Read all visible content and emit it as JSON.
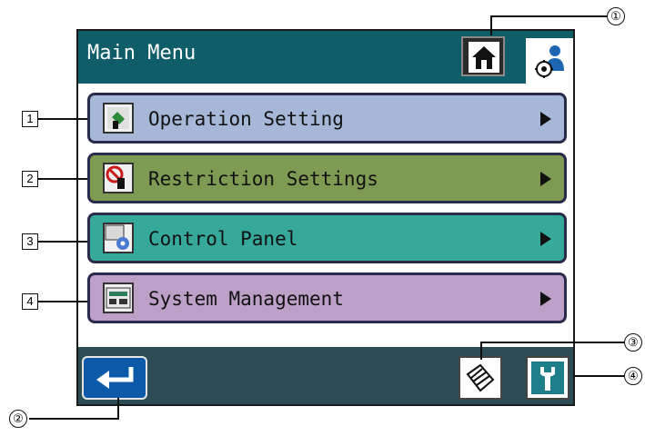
{
  "header": {
    "title": "Main Menu"
  },
  "menu": {
    "items": [
      {
        "label": "Operation Setting",
        "callout": "1",
        "color": "#a7b7d8"
      },
      {
        "label": "Restriction Settings",
        "callout": "2",
        "color": "#7f9a52"
      },
      {
        "label": "Control Panel",
        "callout": "3",
        "color": "#36a99a"
      },
      {
        "label": "System Management",
        "callout": "4",
        "color": "#bca0c8"
      }
    ]
  },
  "callouts": {
    "home": "①",
    "back": "②",
    "btn3": "③",
    "btn4": "④"
  },
  "icons": {
    "home": "home-icon",
    "user_settings": "user-settings-icon",
    "back": "return-arrow-icon",
    "pages": "pages-icon",
    "wrench": "wrench-icon"
  },
  "colors": {
    "titlebar": "#0e5d68",
    "bottombar": "#2c4d55",
    "back_button": "#0c5aa8"
  }
}
